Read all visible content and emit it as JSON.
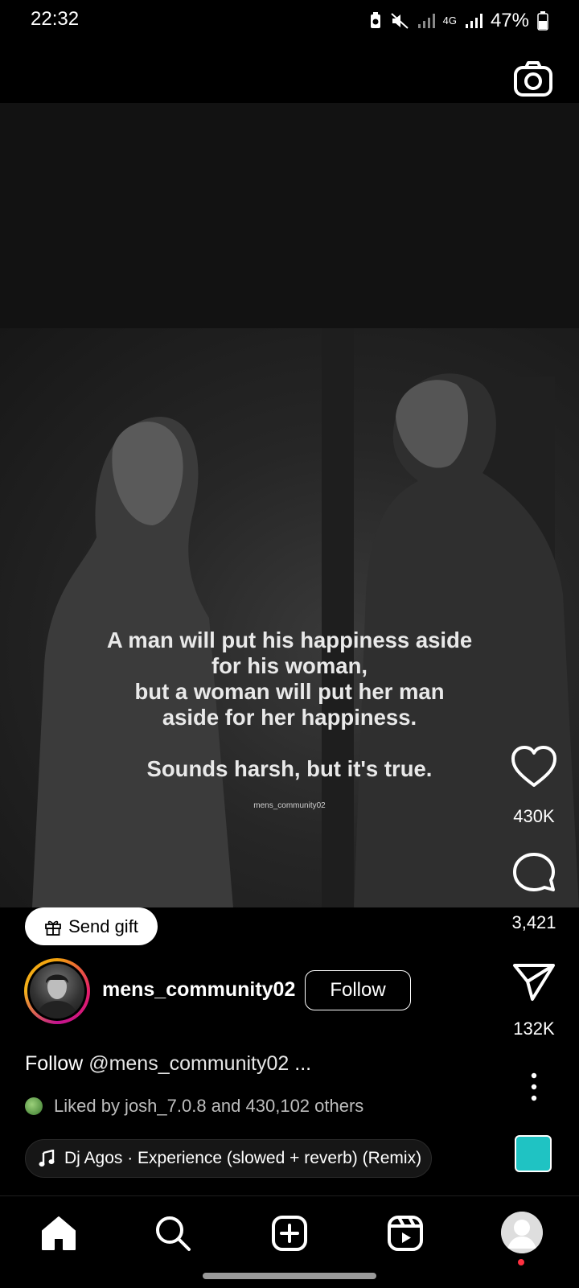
{
  "status_bar": {
    "time": "22:32",
    "network": "4G",
    "battery": "47%",
    "icons": [
      "battery-saver-icon",
      "mute-icon",
      "signal-icon",
      "4g-icon",
      "signal-icon",
      "battery-icon"
    ]
  },
  "post": {
    "quote_lines": [
      "A man will put his happiness aside",
      "for his woman,",
      "but a woman will put her man",
      "aside for her happiness.",
      "",
      "Sounds harsh, but it's true."
    ],
    "watermark": "mens_community02"
  },
  "actions": {
    "like_count": "430K",
    "comment_count": "3,421",
    "share_count": "132K"
  },
  "gift_button": {
    "label": "Send gift"
  },
  "author": {
    "username": "mens_community02",
    "follow_label": "Follow"
  },
  "caption": {
    "prefix": "Follow",
    "mention": "@mens_community02",
    "more": "..."
  },
  "likes": {
    "text": "Liked by josh_7.0.8 and 430,102 others"
  },
  "music": {
    "title": "Dj Agos · Experience (slowed + reverb) (Remix)",
    "thumb_color": "#1fc3c3"
  },
  "nav": {
    "items": [
      "home-icon",
      "search-icon",
      "create-icon",
      "reels-icon",
      "profile-avatar"
    ],
    "notification_color": "#ff3040"
  }
}
